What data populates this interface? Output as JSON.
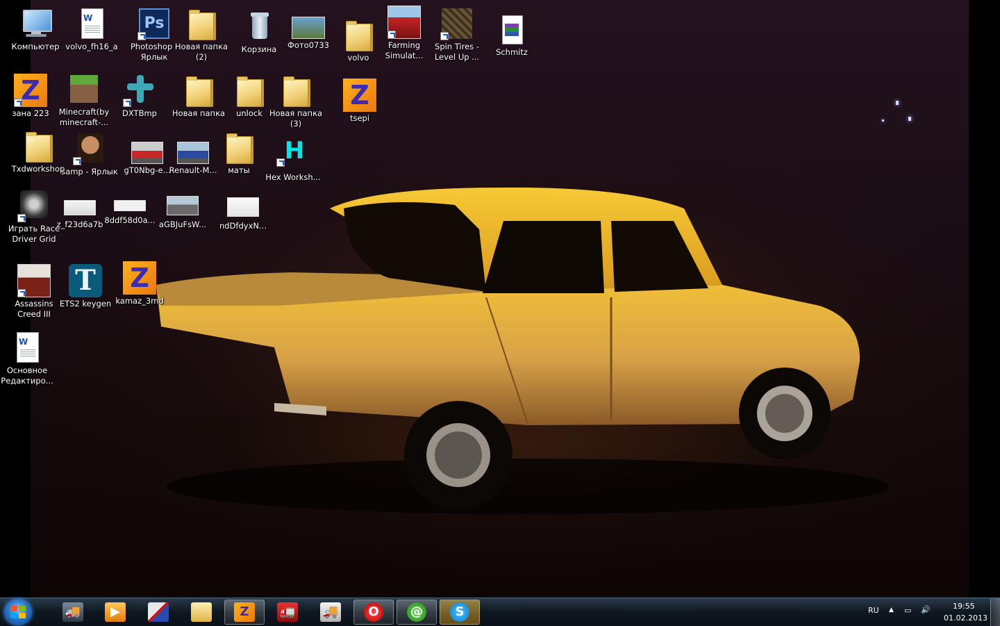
{
  "desktop": {
    "icons": [
      {
        "id": "computer",
        "label": "Компьютер"
      },
      {
        "id": "volvo_fh16",
        "label": "volvo_fh16_a"
      },
      {
        "id": "photoshop",
        "label": "Photoshop - Ярлык"
      },
      {
        "id": "new_folder_2",
        "label": "Новая папка (2)"
      },
      {
        "id": "recycle_bin",
        "label": "Корзина"
      },
      {
        "id": "photo0733",
        "label": "Фото0733"
      },
      {
        "id": "volvo",
        "label": "volvo"
      },
      {
        "id": "farming",
        "label": "Farming Simulat..."
      },
      {
        "id": "spin_tires",
        "label": "Spin Tires - Level Up ..."
      },
      {
        "id": "schmitz",
        "label": "Schmitz"
      },
      {
        "id": "zana223",
        "label": "зана 223"
      },
      {
        "id": "minecraft",
        "label": "Minecraft(by minecraft-..."
      },
      {
        "id": "dxtbmp",
        "label": "DXTBmp"
      },
      {
        "id": "new_folder",
        "label": "Новая папка"
      },
      {
        "id": "unlock",
        "label": "unlock"
      },
      {
        "id": "new_folder_3",
        "label": "Новая папка (3)"
      },
      {
        "id": "tsepi",
        "label": "tsepi"
      },
      {
        "id": "txdworkshop",
        "label": "Txdworkshop"
      },
      {
        "id": "samp",
        "label": "samp - Ярлык"
      },
      {
        "id": "gt0nbg",
        "label": "gT0Nbg-e..."
      },
      {
        "id": "renault",
        "label": "Renault-M..."
      },
      {
        "id": "maty",
        "label": "маты"
      },
      {
        "id": "hex",
        "label": "Hex Worksh..."
      },
      {
        "id": "race_driver",
        "label": "Играть Race Driver Grid"
      },
      {
        "id": "z_f23d",
        "label": "z_f23d6a7b"
      },
      {
        "id": "8ddf",
        "label": "8ddf58d0a..."
      },
      {
        "id": "agbju",
        "label": "aGBJuFsW..."
      },
      {
        "id": "nddfdy",
        "label": "ndDfdyxN..."
      },
      {
        "id": "assassins",
        "label": "Assassins Creed III"
      },
      {
        "id": "ets2",
        "label": "ETS2 keygen"
      },
      {
        "id": "kamaz",
        "label": "kamaz_3md"
      },
      {
        "id": "osnovnoe",
        "label": "Основное Редактиро..."
      }
    ]
  },
  "taskbar": {
    "tray": {
      "language": "RU",
      "time": "19:55",
      "date": "01.02.2013"
    },
    "pinned": [
      {
        "id": "truck1",
        "icon": "truck-icon"
      },
      {
        "id": "media",
        "icon": "media-player-icon"
      },
      {
        "id": "truck2",
        "icon": "scania-icon"
      },
      {
        "id": "explorer",
        "icon": "folder-icon"
      },
      {
        "id": "zmod",
        "icon": "zmodeler-icon"
      },
      {
        "id": "truck3",
        "icon": "red-truck-icon"
      },
      {
        "id": "truck4",
        "icon": "truck-white-icon"
      },
      {
        "id": "opera",
        "icon": "opera-icon"
      },
      {
        "id": "mail",
        "icon": "mail-agent-icon"
      },
      {
        "id": "skype",
        "icon": "skype-icon"
      }
    ]
  }
}
